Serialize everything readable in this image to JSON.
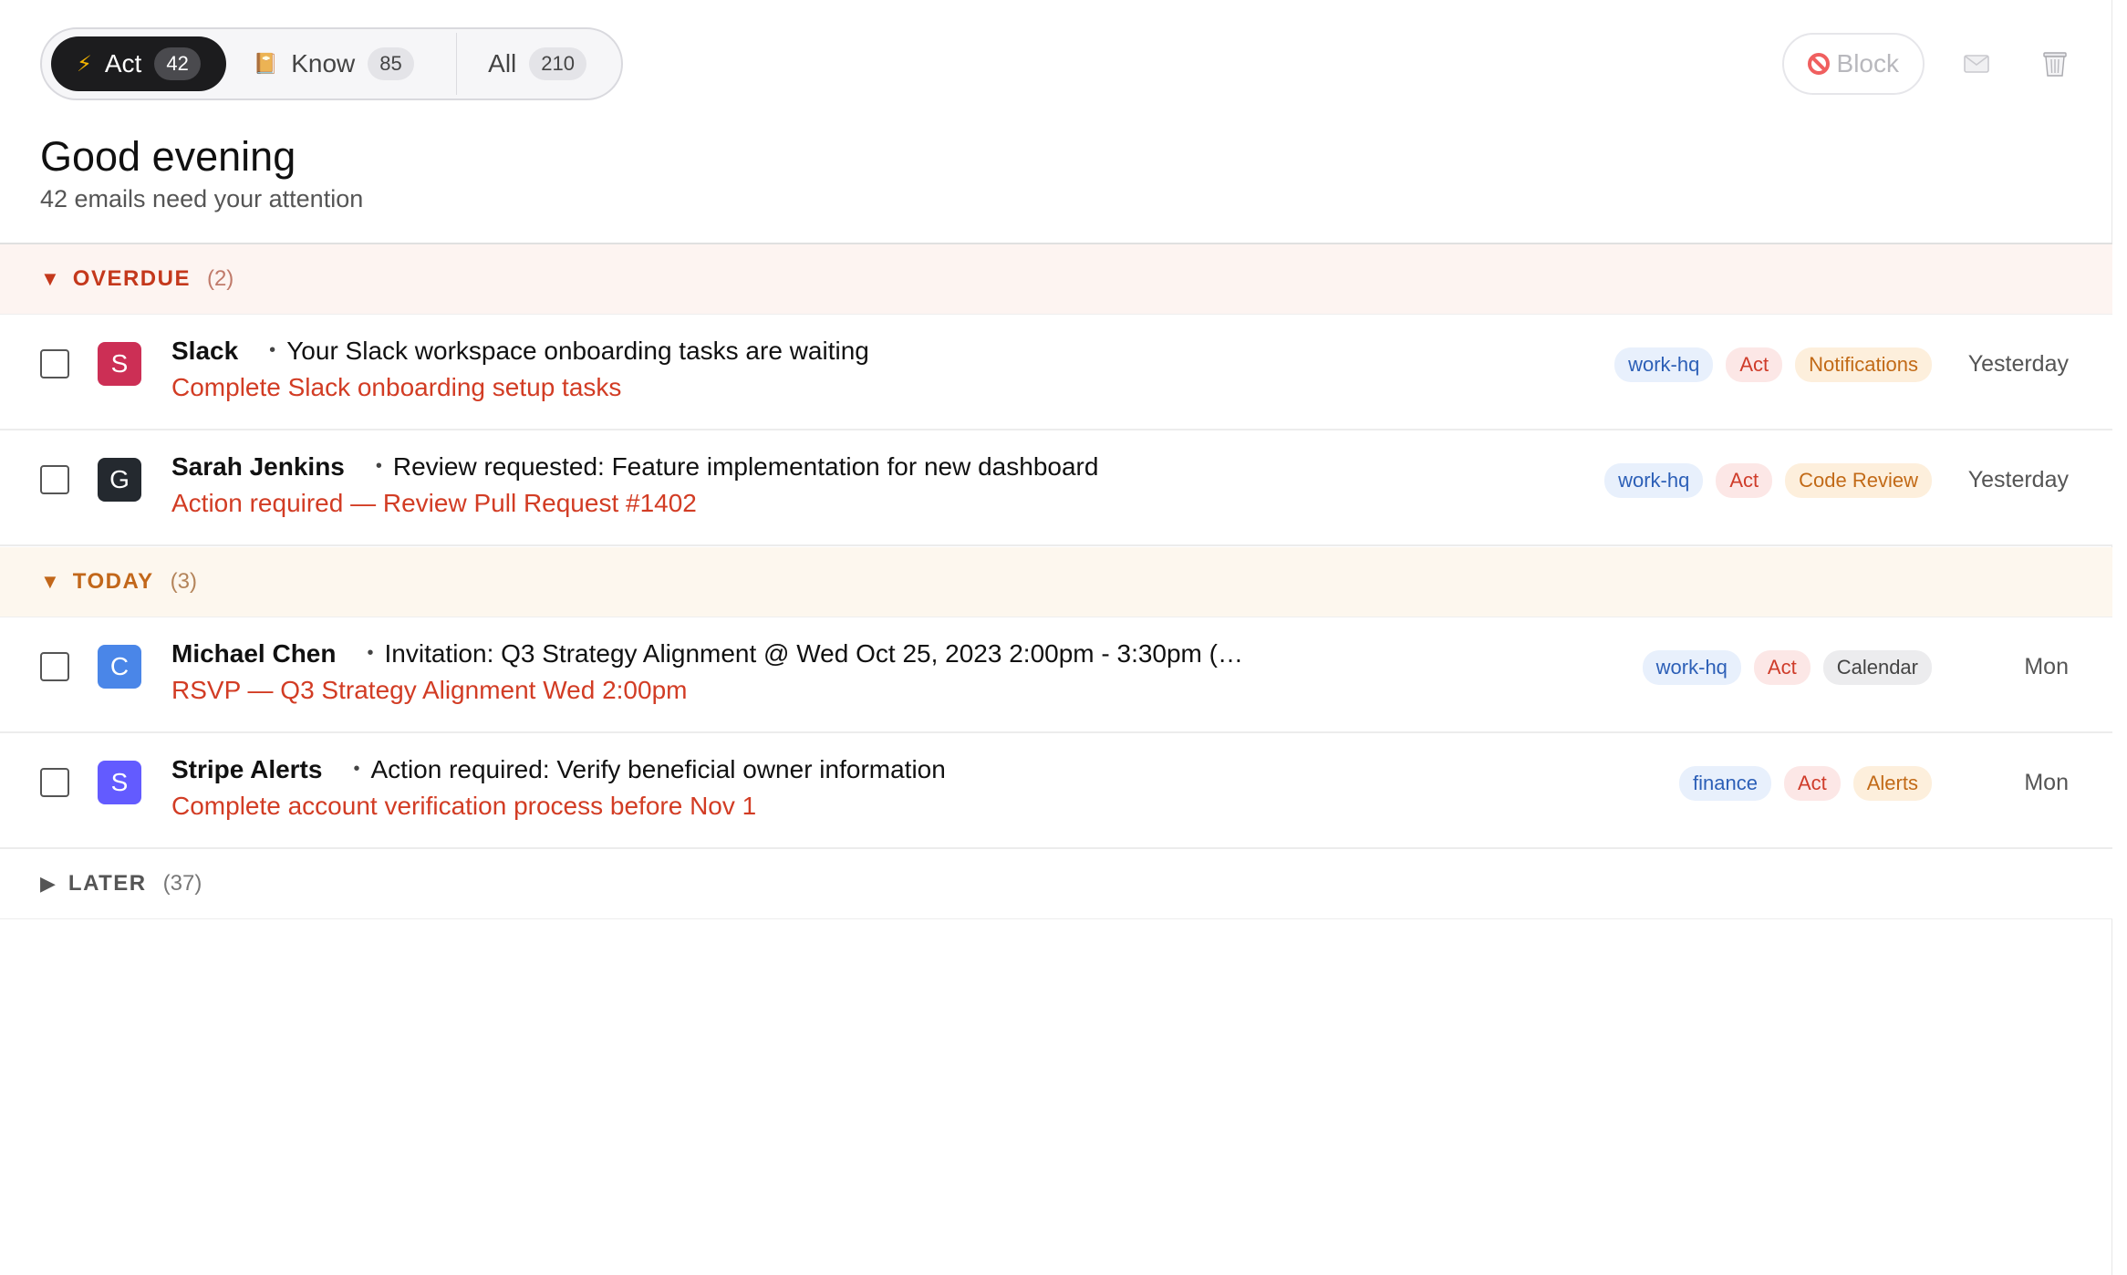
{
  "tabs": [
    {
      "icon": "⚡",
      "label": "Act",
      "count": "42"
    },
    {
      "icon": "📔",
      "label": "Know",
      "count": "85"
    },
    {
      "icon": "",
      "label": "All",
      "count": "210"
    }
  ],
  "toolbar": {
    "block_label": "Block",
    "block_icon": "no-entry-icon",
    "mail_icon": "mail-icon",
    "trash_icon": "trash-icon"
  },
  "greeting": "Good evening",
  "subtitle": "42 emails need your attention",
  "sections": {
    "overdue": {
      "label": "OVERDUE",
      "count": "(2)",
      "arrow": "▼"
    },
    "today": {
      "label": "TODAY",
      "count": "(3)",
      "arrow": "▼"
    },
    "later": {
      "label": "LATER",
      "count": "(37)",
      "arrow": "▶"
    }
  },
  "emails": [
    {
      "avatar": "S",
      "avatar_color": "#cc2f55",
      "sender": "Slack",
      "subject": "Your Slack workspace onboarding tasks are waiting",
      "action": "Complete Slack onboarding setup tasks",
      "tags": [
        "work-hq",
        "Act",
        "Notifications"
      ],
      "date": "Yesterday"
    },
    {
      "avatar": "G",
      "avatar_color": "#24292f",
      "sender": "Sarah Jenkins",
      "subject": "Review requested: Feature implementation for new dashboard",
      "action": "Action required — Review Pull Request #1402",
      "tags": [
        "work-hq",
        "Act",
        "Code Review"
      ],
      "date": "Yesterday"
    },
    {
      "avatar": "C",
      "avatar_color": "#4a86e8",
      "sender": "Michael Chen",
      "subject": "Invitation: Q3 Strategy Alignment @ Wed Oct 25, 2023 2:00pm - 3:30pm (…",
      "action": "RSVP — Q3 Strategy Alignment Wed 2:00pm",
      "tags": [
        "work-hq",
        "Act",
        "Calendar"
      ],
      "date": "Mon"
    },
    {
      "avatar": "S",
      "avatar_color": "#635bff",
      "sender": "Stripe Alerts",
      "subject": "Action required: Verify beneficial owner information",
      "action": "Complete account verification process before Nov 1",
      "tags": [
        "finance",
        "Act",
        "Alerts"
      ],
      "date": "Mon"
    }
  ]
}
